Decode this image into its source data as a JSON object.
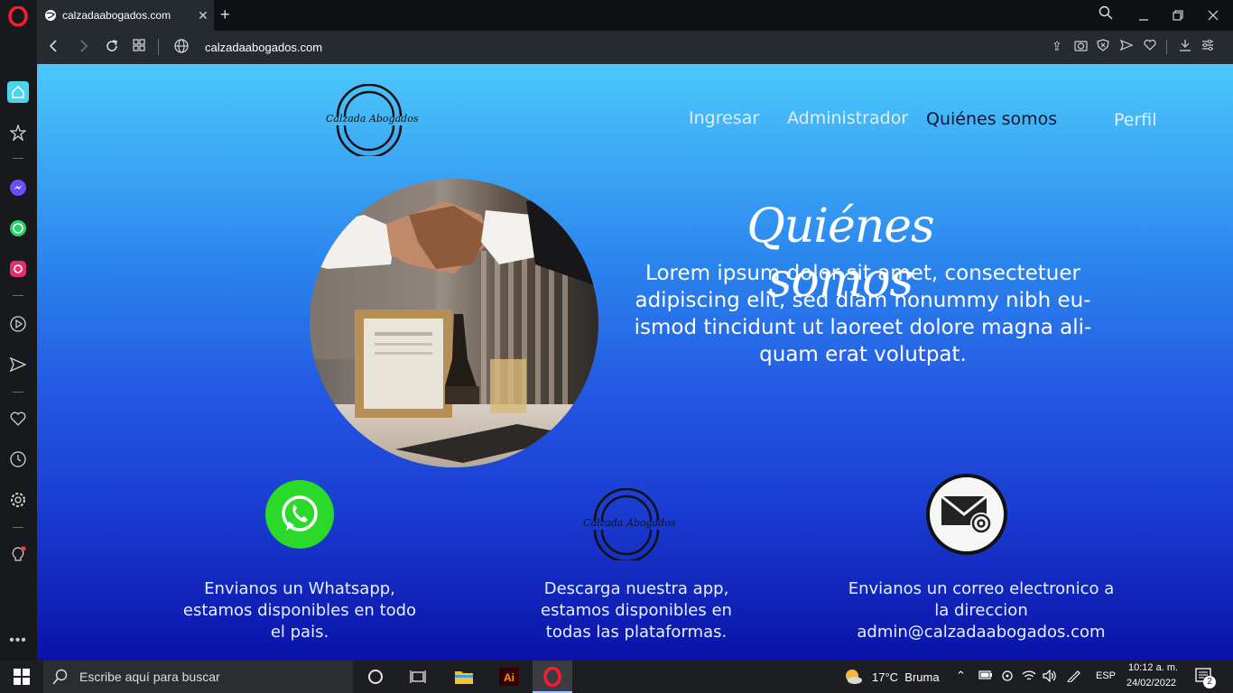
{
  "browser": {
    "tab_title": "calzadaabogados.com",
    "url": "calzadaabogados.com"
  },
  "site": {
    "logo_text": "Calzada Abogados",
    "nav": [
      "Ingresar",
      "Administrador",
      "Quiénes somos",
      "Perfil"
    ],
    "about_title": "Quiénes somos",
    "about_text": "Lorem ipsum dolor sit amet, consectetuer adipiscing elit, sed diam nonummy nibh eu-ismod tincidunt ut laoreet dolore magna ali-quam erat volutpat.",
    "cards": [
      {
        "icon": "whatsapp-icon",
        "text": "Envianos un Whatsapp, estamos disponibles en todo el pais."
      },
      {
        "icon": "app-logo",
        "text": "Descarga nuestra app, estamos disponibles en todas las plataformas."
      },
      {
        "icon": "email-icon",
        "text": "Envianos un correo electronico a la direccion admin@calzadaabogados.com"
      }
    ]
  },
  "taskbar": {
    "search_placeholder": "Escribe aquí para buscar",
    "weather": "17°C  Bruma",
    "lang": "ESP",
    "time": "10:12 a. m.",
    "date": "24/02/2022",
    "notif_count": "2"
  },
  "colors": {
    "gradient_top": "#4cc8fb",
    "gradient_bottom": "#0a12a8",
    "whatsapp": "#2bd92b"
  }
}
